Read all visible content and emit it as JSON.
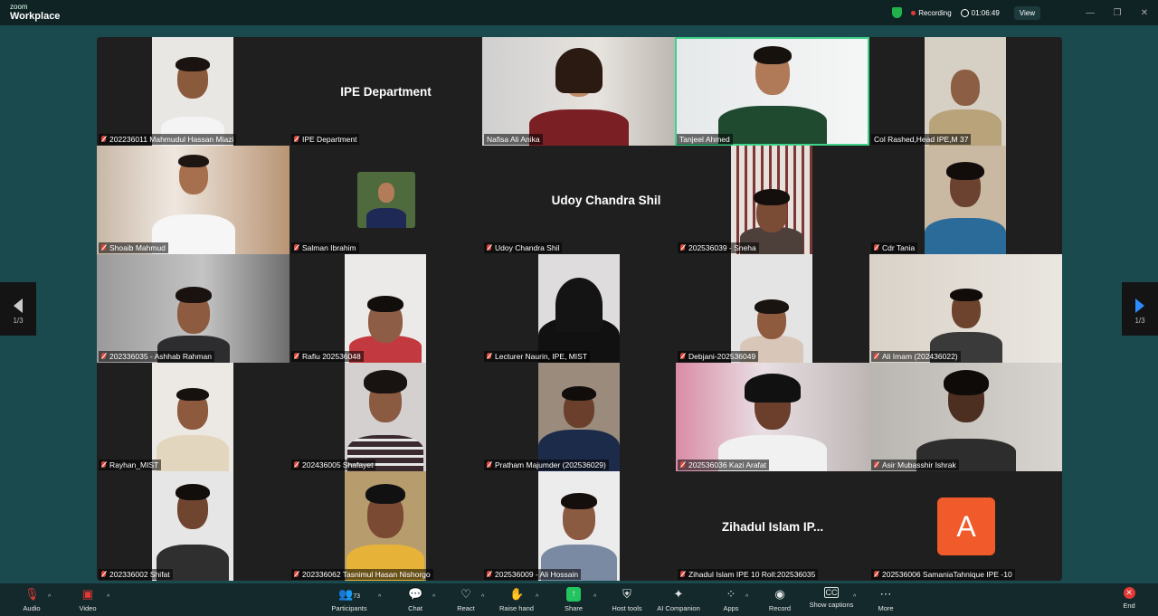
{
  "app": {
    "logo_small": "zoom",
    "logo_big": "Workplace"
  },
  "titlebar": {
    "recording": "Recording",
    "timer": "01:06:49",
    "view": "View",
    "minimize": "—",
    "maximize": "❐",
    "close": "✕"
  },
  "tiles": [
    {
      "name": "202236011 Mahmudul Hassan Miazi"
    },
    {
      "name": "IPE Department",
      "big": "IPE Department"
    },
    {
      "name": "Nafisa Ali Anika"
    },
    {
      "name": "Tanjeel Ahmed"
    },
    {
      "name": "Col Rashed,Head IPE,M 37"
    },
    {
      "name": "Shoaib Mahmud"
    },
    {
      "name": "Salman Ibrahim"
    },
    {
      "name": "Udoy Chandra Shil",
      "big": "Udoy Chandra Shil"
    },
    {
      "name": "202536039 - Sneha"
    },
    {
      "name": "Cdr Tania"
    },
    {
      "name": "202336035 - Ashhab Rahman"
    },
    {
      "name": "Rafiu 202536048"
    },
    {
      "name": "Lecturer Naurin, IPE, MIST"
    },
    {
      "name": "Debjani-202536049"
    },
    {
      "name": "Ali Imam (202436022)"
    },
    {
      "name": "Rayhan_MIST"
    },
    {
      "name": "202436005 Shafayet"
    },
    {
      "name": "Pratham Majumder (202536029)"
    },
    {
      "name": "202536036 Kazi Arafat"
    },
    {
      "name": "Asir Mubasshir Ishrak"
    },
    {
      "name": "202336002 Shifat"
    },
    {
      "name": "202336062 Tasnimul Hasan Nishorgo"
    },
    {
      "name": "202536009 - Ali Hossain"
    },
    {
      "name": "Zihadul Islam IPE 10 Roll:202536035",
      "big": "Zihadul Islam IP..."
    },
    {
      "name": "202536006 SamaniaTahnique IPE -10",
      "avatar": "A"
    }
  ],
  "pager": {
    "left": "1/3",
    "right": "1/3"
  },
  "toolbar": {
    "audio": "Audio",
    "video": "Video",
    "participants": "Participants",
    "participants_count": "73",
    "chat": "Chat",
    "react": "React",
    "raise_hand": "Raise hand",
    "share": "Share",
    "host_tools": "Host tools",
    "ai_companion": "AI Companion",
    "apps": "Apps",
    "record": "Record",
    "show_captions": "Show captions",
    "more": "More",
    "end": "End"
  },
  "colors": {
    "accent_green": "#3fd28a",
    "end_red": "#e53935",
    "share_green": "#22c55e",
    "avatar_orange": "#f15a2b"
  }
}
